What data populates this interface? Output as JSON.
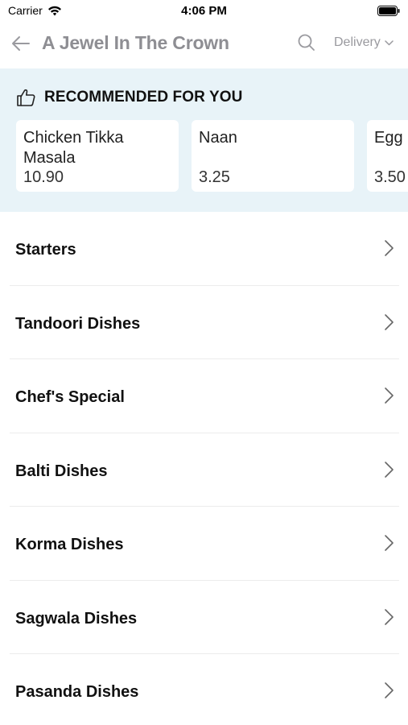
{
  "status_bar": {
    "carrier": "Carrier",
    "time": "4:06 PM"
  },
  "nav": {
    "title": "A Jewel In The Crown",
    "delivery_label": "Delivery"
  },
  "recommended": {
    "title": "RECOMMENDED FOR YOU",
    "items": [
      {
        "name": "Chicken Tikka Masala",
        "price": "10.90"
      },
      {
        "name": "Naan",
        "price": "3.25"
      },
      {
        "name": "Egg Fried Rice",
        "price": "3.50"
      }
    ]
  },
  "categories": [
    {
      "label": "Starters"
    },
    {
      "label": "Tandoori Dishes"
    },
    {
      "label": "Chef's Special"
    },
    {
      "label": "Balti Dishes"
    },
    {
      "label": "Korma Dishes"
    },
    {
      "label": "Sagwala Dishes"
    },
    {
      "label": "Pasanda Dishes"
    }
  ],
  "colors": {
    "reco_bg": "#e8f3f8",
    "nav_title": "#8e8e93"
  }
}
